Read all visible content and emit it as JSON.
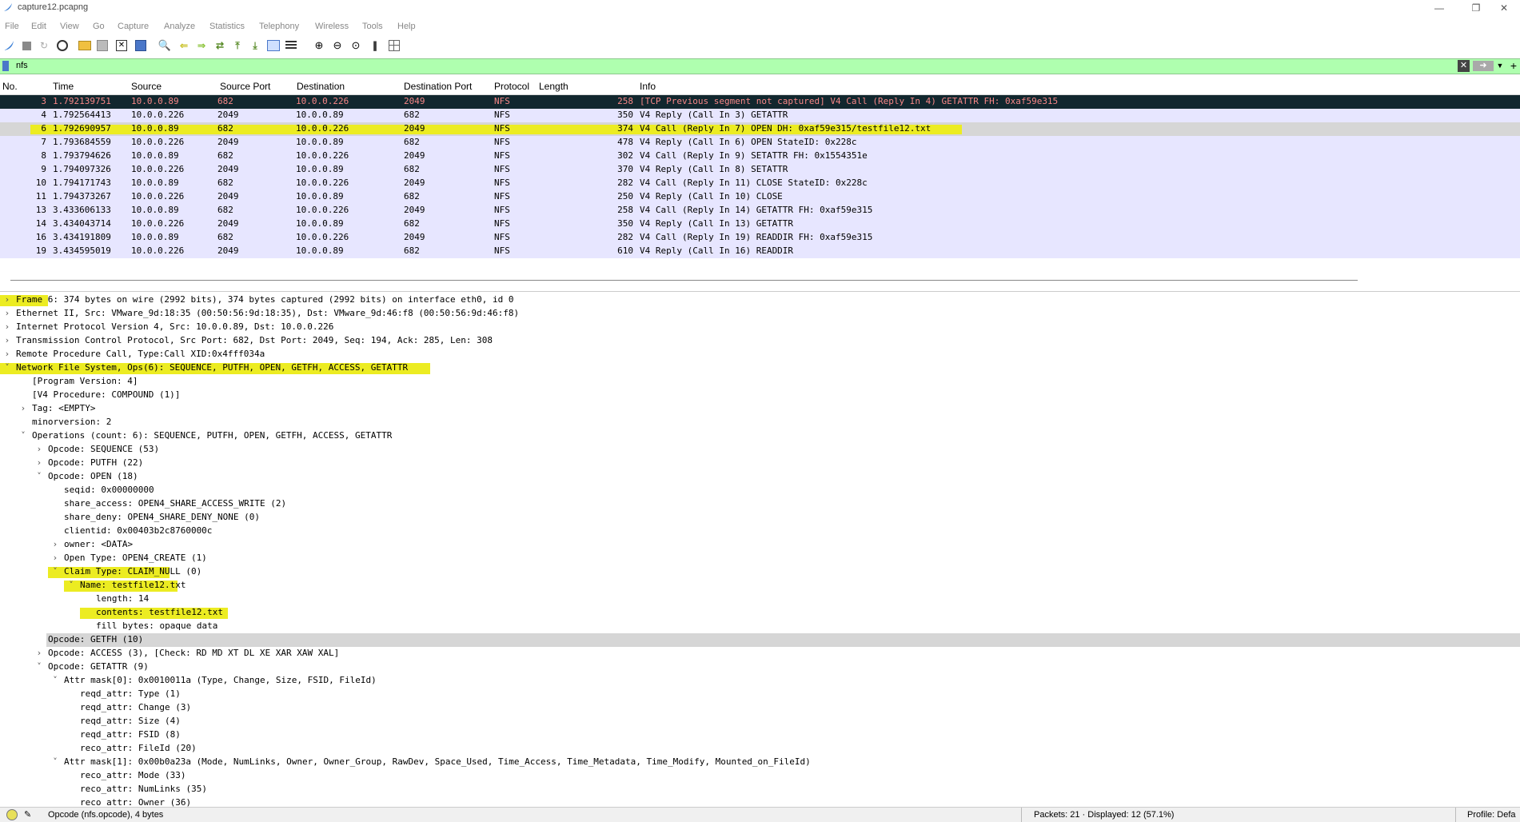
{
  "window": {
    "title": "capture12.pcapng"
  },
  "menu": [
    "File",
    "Edit",
    "View",
    "Go",
    "Capture",
    "Analyze",
    "Statistics",
    "Telephony",
    "Wireless",
    "Tools",
    "Help"
  ],
  "filter": {
    "value": "nfs"
  },
  "columns": [
    "No.",
    "Time",
    "Source",
    "Source Port",
    "Destination",
    "Destination Port",
    "Protocol",
    "Length",
    "Info"
  ],
  "packets": [
    {
      "no": "3",
      "time": "1.792139751",
      "src": "10.0.0.89",
      "sport": "682",
      "dst": "10.0.0.226",
      "dport": "2049",
      "proto": "NFS",
      "len": "258",
      "info": "[TCP Previous segment not captured] V4 Call (Reply In 4) GETATTR FH: 0xaf59e315"
    },
    {
      "no": "4",
      "time": "1.792564413",
      "src": "10.0.0.226",
      "sport": "2049",
      "dst": "10.0.0.89",
      "dport": "682",
      "proto": "NFS",
      "len": "350",
      "info": "V4 Reply (Call In 3) GETATTR"
    },
    {
      "no": "6",
      "time": "1.792690957",
      "src": "10.0.0.89",
      "sport": "682",
      "dst": "10.0.0.226",
      "dport": "2049",
      "proto": "NFS",
      "len": "374",
      "info": "V4 Call (Reply In 7) OPEN DH: 0xaf59e315/testfile12.txt"
    },
    {
      "no": "7",
      "time": "1.793684559",
      "src": "10.0.0.226",
      "sport": "2049",
      "dst": "10.0.0.89",
      "dport": "682",
      "proto": "NFS",
      "len": "478",
      "info": "V4 Reply (Call In 6) OPEN StateID: 0x228c"
    },
    {
      "no": "8",
      "time": "1.793794626",
      "src": "10.0.0.89",
      "sport": "682",
      "dst": "10.0.0.226",
      "dport": "2049",
      "proto": "NFS",
      "len": "302",
      "info": "V4 Call (Reply In 9) SETATTR FH: 0x1554351e"
    },
    {
      "no": "9",
      "time": "1.794097326",
      "src": "10.0.0.226",
      "sport": "2049",
      "dst": "10.0.0.89",
      "dport": "682",
      "proto": "NFS",
      "len": "370",
      "info": "V4 Reply (Call In 8) SETATTR"
    },
    {
      "no": "10",
      "time": "1.794171743",
      "src": "10.0.0.89",
      "sport": "682",
      "dst": "10.0.0.226",
      "dport": "2049",
      "proto": "NFS",
      "len": "282",
      "info": "V4 Call (Reply In 11) CLOSE StateID: 0x228c"
    },
    {
      "no": "11",
      "time": "1.794373267",
      "src": "10.0.0.226",
      "sport": "2049",
      "dst": "10.0.0.89",
      "dport": "682",
      "proto": "NFS",
      "len": "250",
      "info": "V4 Reply (Call In 10) CLOSE"
    },
    {
      "no": "13",
      "time": "3.433606133",
      "src": "10.0.0.89",
      "sport": "682",
      "dst": "10.0.0.226",
      "dport": "2049",
      "proto": "NFS",
      "len": "258",
      "info": "V4 Call (Reply In 14) GETATTR FH: 0xaf59e315"
    },
    {
      "no": "14",
      "time": "3.434043714",
      "src": "10.0.0.226",
      "sport": "2049",
      "dst": "10.0.0.89",
      "dport": "682",
      "proto": "NFS",
      "len": "350",
      "info": "V4 Reply (Call In 13) GETATTR"
    },
    {
      "no": "16",
      "time": "3.434191809",
      "src": "10.0.0.89",
      "sport": "682",
      "dst": "10.0.0.226",
      "dport": "2049",
      "proto": "NFS",
      "len": "282",
      "info": "V4 Call (Reply In 19) READDIR FH: 0xaf59e315"
    },
    {
      "no": "19",
      "time": "3.434595019",
      "src": "10.0.0.226",
      "sport": "2049",
      "dst": "10.0.0.89",
      "dport": "682",
      "proto": "NFS",
      "len": "610",
      "info": "V4 Reply (Call In 16) READDIR"
    }
  ],
  "details": [
    {
      "text": "Frame 6: 374 bytes on wire (2992 bits), 374 bytes captured (2992 bits) on interface eth0, id 0",
      "lvl": 0,
      "exp": ">"
    },
    {
      "text": "Ethernet II, Src: VMware_9d:18:35 (00:50:56:9d:18:35), Dst: VMware_9d:46:f8 (00:50:56:9d:46:f8)",
      "lvl": 0,
      "exp": ">"
    },
    {
      "text": "Internet Protocol Version 4, Src: 10.0.0.89, Dst: 10.0.0.226",
      "lvl": 0,
      "exp": ">"
    },
    {
      "text": "Transmission Control Protocol, Src Port: 682, Dst Port: 2049, Seq: 194, Ack: 285, Len: 308",
      "lvl": 0,
      "exp": ">"
    },
    {
      "text": "Remote Procedure Call, Type:Call XID:0x4fff034a",
      "lvl": 0,
      "exp": ">"
    },
    {
      "text": "Network File System, Ops(6): SEQUENCE, PUTFH, OPEN, GETFH, ACCESS, GETATTR",
      "lvl": 0,
      "exp": "v"
    },
    {
      "text": "[Program Version: 4]",
      "lvl": 1,
      "exp": ""
    },
    {
      "text": "[V4 Procedure: COMPOUND (1)]",
      "lvl": 1,
      "exp": ""
    },
    {
      "text": "Tag: <EMPTY>",
      "lvl": 1,
      "exp": ">"
    },
    {
      "text": "minorversion: 2",
      "lvl": 1,
      "exp": ""
    },
    {
      "text": "Operations (count: 6): SEQUENCE, PUTFH, OPEN, GETFH, ACCESS, GETATTR",
      "lvl": 1,
      "exp": "v"
    },
    {
      "text": "Opcode: SEQUENCE (53)",
      "lvl": 2,
      "exp": ">"
    },
    {
      "text": "Opcode: PUTFH (22)",
      "lvl": 2,
      "exp": ">"
    },
    {
      "text": "Opcode: OPEN (18)",
      "lvl": 2,
      "exp": "v"
    },
    {
      "text": "seqid: 0x00000000",
      "lvl": 3,
      "exp": ""
    },
    {
      "text": "share_access: OPEN4_SHARE_ACCESS_WRITE (2)",
      "lvl": 3,
      "exp": ""
    },
    {
      "text": "share_deny: OPEN4_SHARE_DENY_NONE (0)",
      "lvl": 3,
      "exp": ""
    },
    {
      "text": "clientid: 0x00403b2c8760000c",
      "lvl": 3,
      "exp": ""
    },
    {
      "text": "owner: <DATA>",
      "lvl": 3,
      "exp": ">"
    },
    {
      "text": "Open Type: OPEN4_CREATE (1)",
      "lvl": 3,
      "exp": ">"
    },
    {
      "text": "Claim Type: CLAIM_NULL (0)",
      "lvl": 3,
      "exp": "v"
    },
    {
      "text": "Name: testfile12.txt",
      "lvl": 4,
      "exp": "v"
    },
    {
      "text": "length: 14",
      "lvl": 5,
      "exp": ""
    },
    {
      "text": "contents: testfile12.txt",
      "lvl": 5,
      "exp": ""
    },
    {
      "text": "fill bytes: opaque data",
      "lvl": 5,
      "exp": ""
    },
    {
      "text": "Opcode: GETFH (10)",
      "lvl": 2,
      "exp": ""
    },
    {
      "text": "Opcode: ACCESS (3), [Check: RD MD XT DL XE XAR XAW XAL]",
      "lvl": 2,
      "exp": ">"
    },
    {
      "text": "Opcode: GETATTR (9)",
      "lvl": 2,
      "exp": "v"
    },
    {
      "text": "Attr mask[0]: 0x0010011a (Type, Change, Size, FSID, FileId)",
      "lvl": 3,
      "exp": "v"
    },
    {
      "text": "reqd_attr: Type (1)",
      "lvl": 4,
      "exp": ""
    },
    {
      "text": "reqd_attr: Change (3)",
      "lvl": 4,
      "exp": ""
    },
    {
      "text": "reqd_attr: Size (4)",
      "lvl": 4,
      "exp": ""
    },
    {
      "text": "reqd_attr: FSID (8)",
      "lvl": 4,
      "exp": ""
    },
    {
      "text": "reco_attr: FileId (20)",
      "lvl": 4,
      "exp": ""
    },
    {
      "text": "Attr mask[1]: 0x00b0a23a (Mode, NumLinks, Owner, Owner_Group, RawDev, Space_Used, Time_Access, Time_Metadata, Time_Modify, Mounted_on_FileId)",
      "lvl": 3,
      "exp": "v"
    },
    {
      "text": "reco_attr: Mode (33)",
      "lvl": 4,
      "exp": ""
    },
    {
      "text": "reco_attr: NumLinks (35)",
      "lvl": 4,
      "exp": ""
    },
    {
      "text": "reco_attr: Owner (36)",
      "lvl": 4,
      "exp": ""
    }
  ],
  "status": {
    "field": "Opcode (nfs.opcode), 4 bytes",
    "packets": "Packets: 21 · Displayed: 12 (57.1%)",
    "profile": "Profile: Defa"
  }
}
